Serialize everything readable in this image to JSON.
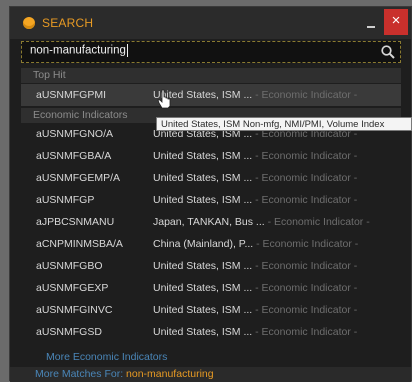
{
  "title": "SEARCH",
  "window_controls": {
    "close": "×"
  },
  "search": {
    "value": "non-manufacturing"
  },
  "top_hit": {
    "header": "Top Hit",
    "row": {
      "ticker": "aUSNMFGPMI",
      "desc": "United States, ISM ...",
      "cat": " - Economic Indicator -"
    }
  },
  "tooltip": "United States, ISM Non-mfg, NMI/PMI, Volume Index",
  "econ": {
    "header": "Economic Indicators",
    "rows": [
      {
        "ticker": "aUSNMFGNO/A",
        "desc": "United States, ISM ...",
        "cat": " - Economic Indicator -"
      },
      {
        "ticker": "aUSNMFGBA/A",
        "desc": "United States, ISM ...",
        "cat": " - Economic Indicator -"
      },
      {
        "ticker": "aUSNMFGEMP/A",
        "desc": "United States, ISM ...",
        "cat": " - Economic Indicator -"
      },
      {
        "ticker": "aUSNMFGP",
        "desc": "United States, ISM ...",
        "cat": " - Economic Indicator -"
      },
      {
        "ticker": "aJPBCSNMANU",
        "desc": "Japan, TANKAN, Bus ...",
        "cat": " - Economic Indicator -"
      },
      {
        "ticker": "aCNPMINMSBA/A",
        "desc": "China (Mainland), P...",
        "cat": " - Economic Indicator -"
      },
      {
        "ticker": "aUSNMFGBO",
        "desc": "United States, ISM ...",
        "cat": " - Economic Indicator -"
      },
      {
        "ticker": "aUSNMFGEXP",
        "desc": "United States, ISM ...",
        "cat": " - Economic Indicator -"
      },
      {
        "ticker": "aUSNMFGINVC",
        "desc": "United States, ISM ...",
        "cat": " - Economic Indicator -"
      },
      {
        "ticker": "aUSNMFGSD",
        "desc": "United States, ISM ...",
        "cat": " - Economic Indicator -"
      }
    ],
    "more_link": "More Economic Indicators"
  },
  "footer": {
    "prefix": "More Matches For: ",
    "term": "non-manufacturing"
  },
  "colors": {
    "accent": "#e79a24",
    "link": "#4a86b8",
    "close": "#c9302c"
  }
}
